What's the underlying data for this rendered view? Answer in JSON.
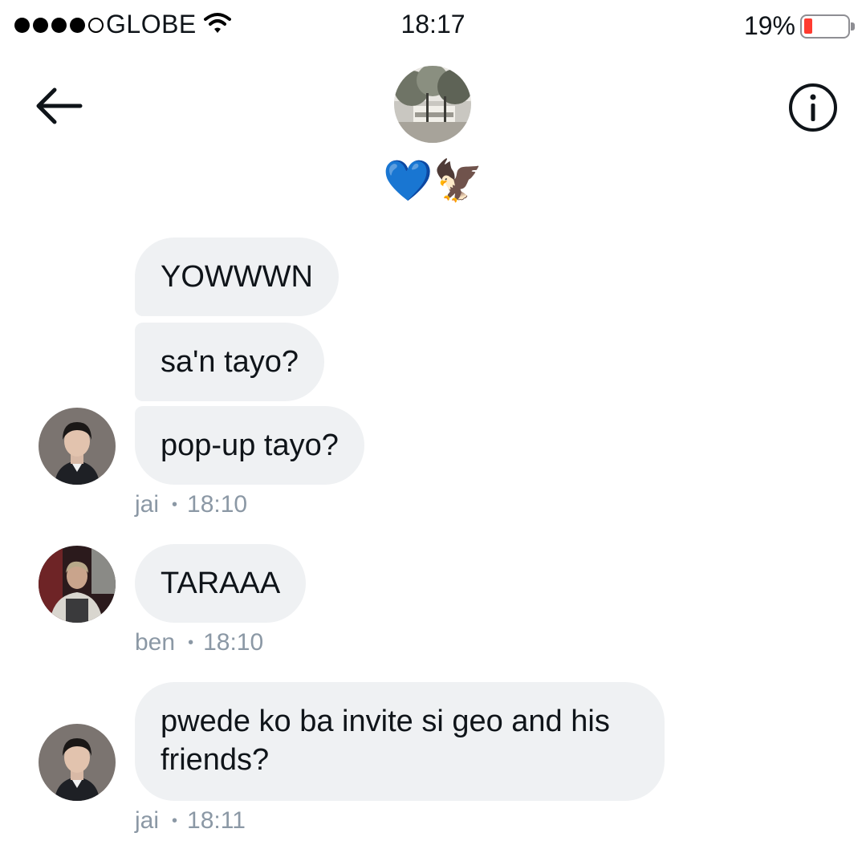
{
  "status_bar": {
    "carrier": "GLOBE",
    "time": "18:17",
    "battery_percent": "19%",
    "battery_level": 0.19,
    "signal_bars": 4,
    "signal_max": 5
  },
  "header": {
    "group_name": "💙🦅",
    "back_icon": "arrow-left-icon",
    "info_icon": "info-circle-icon"
  },
  "messages": [
    {
      "text": "YOWWWN"
    },
    {
      "text": "sa'n tayo?"
    },
    {
      "text": "pop-up tayo?"
    },
    {
      "text": "TARAAA"
    },
    {
      "text": "pwede ko ba invite si geo and his friends?"
    }
  ],
  "meta": [
    {
      "sender": "jai",
      "time": "18:10"
    },
    {
      "sender": "ben",
      "time": "18:10"
    },
    {
      "sender": "jai",
      "time": "18:11"
    }
  ],
  "colors": {
    "bubble_bg": "#eff1f3",
    "meta_text": "#8b98a5",
    "battery_low": "#ff3b30"
  }
}
